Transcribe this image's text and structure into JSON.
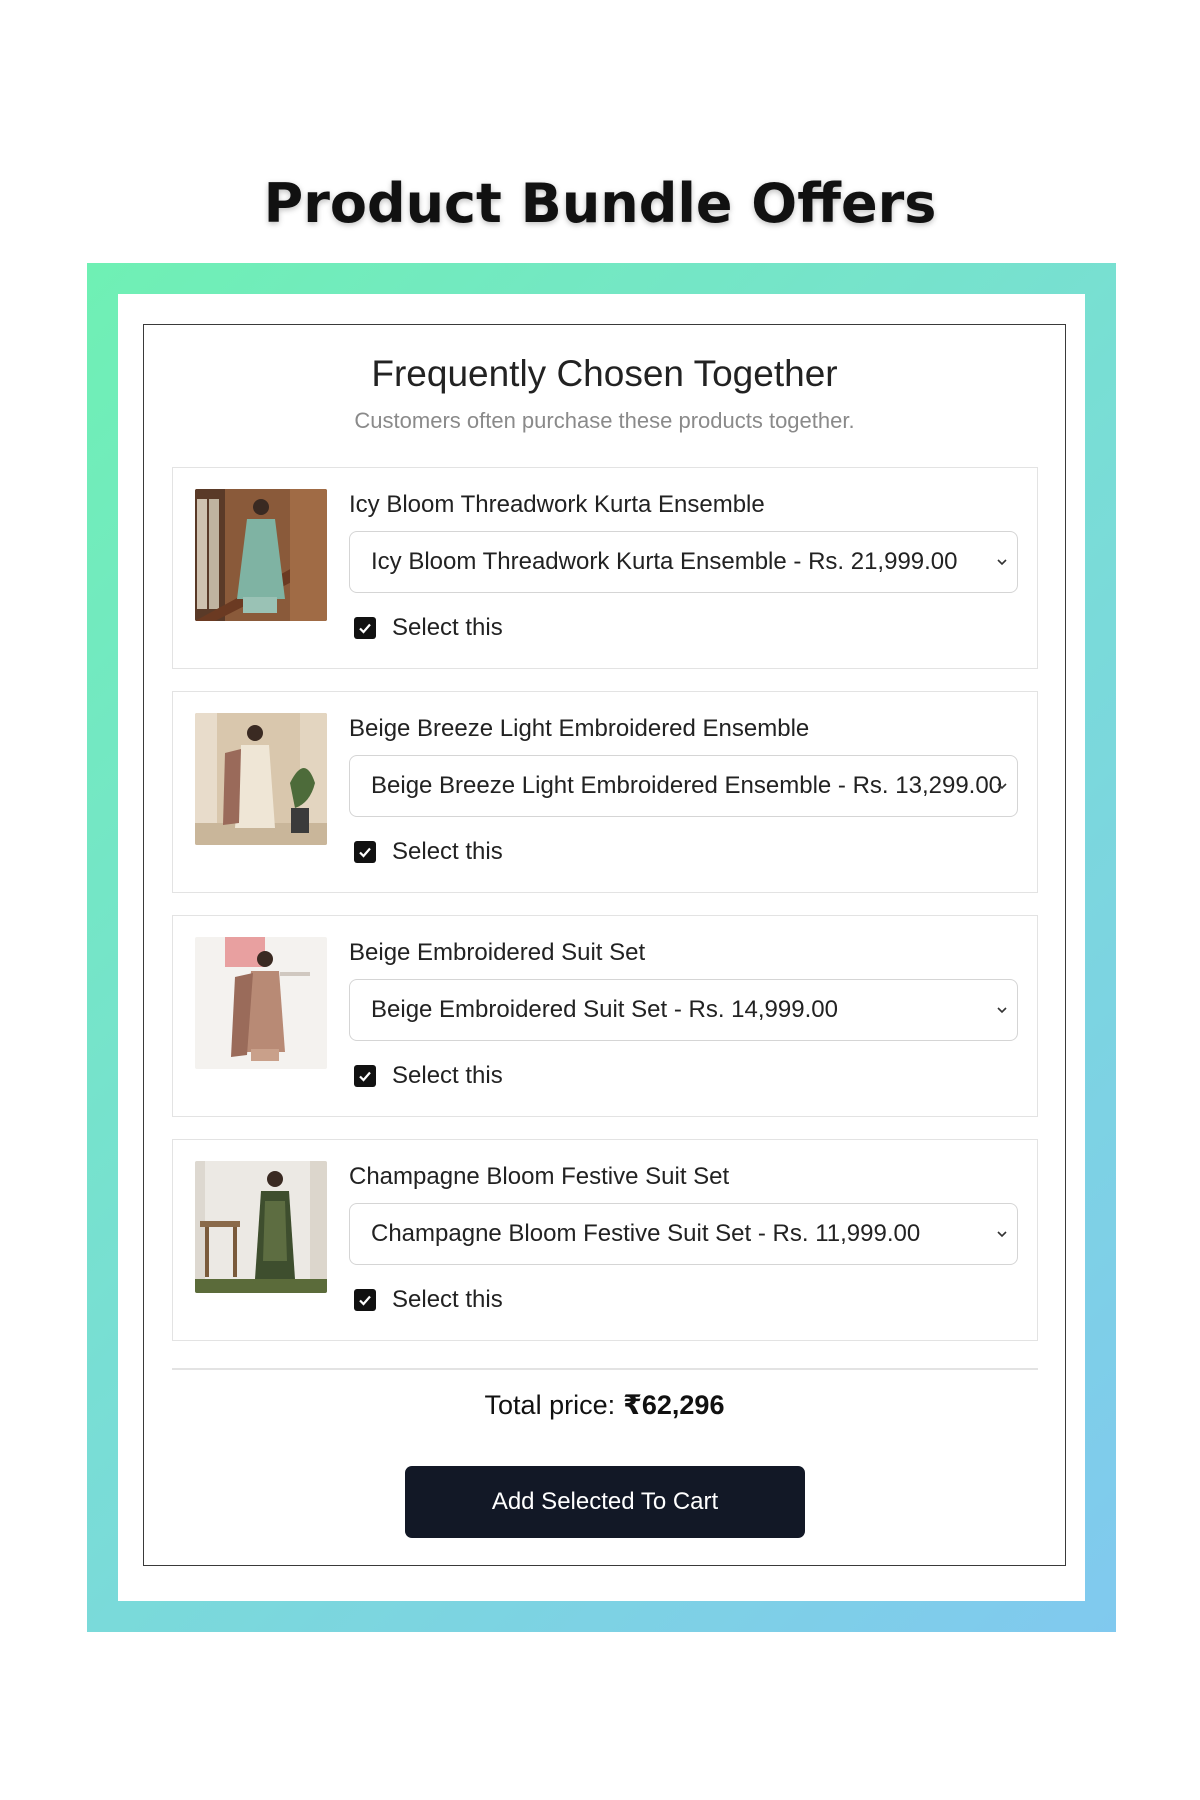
{
  "banner": {
    "title": "Product Bundle Offers"
  },
  "widget": {
    "title": "Frequently Chosen Together",
    "subtitle": "Customers often purchase these products together."
  },
  "items": [
    {
      "name": "Icy Bloom Threadwork Kurta Ensemble",
      "variant": "Icy Bloom Threadwork Kurta Ensemble - Rs. 21,999.00",
      "checkbox_label": "Select this",
      "checked": true
    },
    {
      "name": "Beige Breeze Light Embroidered Ensemble",
      "variant": "Beige Breeze Light Embroidered Ensemble - Rs. 13,299.00",
      "checkbox_label": "Select this",
      "checked": true
    },
    {
      "name": "Beige Embroidered Suit Set",
      "variant": "Beige Embroidered Suit Set - Rs. 14,999.00",
      "checkbox_label": "Select this",
      "checked": true
    },
    {
      "name": "Champagne Bloom Festive Suit Set",
      "variant": "Champagne Bloom Festive Suit Set - Rs. 11,999.00",
      "checkbox_label": "Select this",
      "checked": true
    }
  ],
  "total": {
    "label": "Total price:",
    "amount": "₹62,296"
  },
  "cart_button": {
    "label": "Add Selected To Cart"
  },
  "colors": {
    "gradient_start": "#6ff0b4",
    "gradient_end": "#80c9ef",
    "button_bg": "#121826",
    "checkbox": "#111111"
  }
}
